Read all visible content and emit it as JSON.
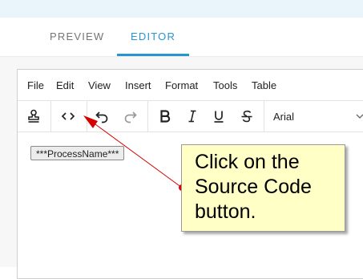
{
  "tabs": {
    "preview_label": "PREVIEW",
    "editor_label": "EDITOR",
    "active": "editor"
  },
  "menubar": {
    "items": [
      "File",
      "Edit",
      "View",
      "Insert",
      "Format",
      "Tools",
      "Table"
    ]
  },
  "toolbar": {
    "icons": [
      "stamp-icon",
      "source-code-icon",
      "undo-icon",
      "redo-icon",
      "bold-icon",
      "italic-icon",
      "underline-icon",
      "strikethrough-icon"
    ],
    "font_family_value": "Arial"
  },
  "content": {
    "token_text": "***ProcessName***"
  },
  "callout": {
    "text": "Click on the Source Code button."
  },
  "colors": {
    "accent": "#2596d1",
    "callout_bg": "#ffffc6",
    "arrow": "#d60000"
  }
}
